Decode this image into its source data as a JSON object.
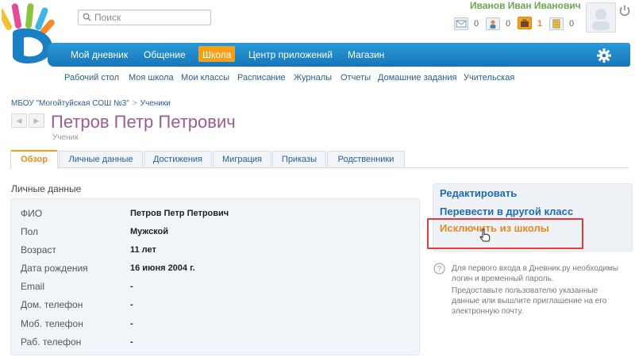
{
  "search": {
    "placeholder": "Поиск"
  },
  "user": {
    "name": "Иванов Иван Иванович",
    "notifications": [
      {
        "icon": "envelope-icon",
        "count": "0"
      },
      {
        "icon": "people-icon",
        "count": "0"
      },
      {
        "icon": "briefcase-icon",
        "count": "1"
      },
      {
        "icon": "document-icon",
        "count": "0"
      }
    ]
  },
  "nav": {
    "items": [
      "Мой дневник",
      "Общение",
      "Школа",
      "Центр приложений",
      "Магазин"
    ],
    "active": "Школа"
  },
  "subnav": {
    "items": [
      "Рабочий стол",
      "Моя школа",
      "Мои классы",
      "Расписание",
      "Журналы",
      "Отчеты",
      "Домашние задания",
      "Учительская"
    ]
  },
  "breadcrumb": {
    "school": "МБОУ \"Могойтуйская СОШ №3\"",
    "separator": ">",
    "section": "Ученики"
  },
  "pager": {
    "prev": "◀",
    "next": "▶"
  },
  "page": {
    "title": "Петров Петр Петрович",
    "subtitle": "Ученик"
  },
  "tabs": [
    "Обзор",
    "Личные данные",
    "Достижения",
    "Миграция",
    "Приказы",
    "Родственники"
  ],
  "personal": {
    "heading": "Личные данные",
    "rows": [
      {
        "label": "ФИО",
        "value": "Петров Петр Петрович"
      },
      {
        "label": "Пол",
        "value": "Мужской"
      },
      {
        "label": "Возраст",
        "value": "11 лет"
      },
      {
        "label": "Дата рождения",
        "value": "16 июня 2004 г."
      },
      {
        "label": "Email",
        "value": "-"
      },
      {
        "label": "Дом. телефон",
        "value": "-"
      },
      {
        "label": "Моб. телефон",
        "value": "-"
      },
      {
        "label": "Раб. телефон",
        "value": "-"
      }
    ]
  },
  "actions": {
    "edit": "Редактировать",
    "transfer": "Перевести в другой класс",
    "exclude": "Исключить из школы"
  },
  "help": {
    "line1": "Для первого входа в Дневник.ру необходимы логин и временный пароль.",
    "line2": "Предоставьте пользователю указанные данные или вышлите приглашение на его электронную почту."
  },
  "colors": {
    "nav_blue": "#1e88c8",
    "accent_orange": "#f6a01a",
    "title_purple": "#9c5c92",
    "highlight_red": "#e23b3b",
    "user_green": "#6aa84f"
  }
}
